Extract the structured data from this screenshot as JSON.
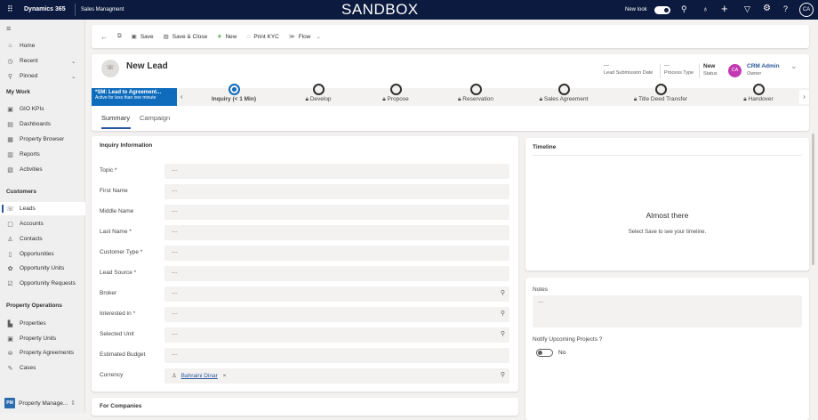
{
  "topbar": {
    "app": "Dynamics 365",
    "area": "Sales Managment",
    "env": "SANDBOX",
    "new_look": "New look",
    "avatar": "CA"
  },
  "sidebar": {
    "items_top": [
      {
        "icon": "home-icon",
        "label": "Home"
      },
      {
        "icon": "clock-icon",
        "label": "Recent"
      },
      {
        "icon": "pin-icon",
        "label": "Pinned"
      }
    ],
    "sections": [
      {
        "title": "My Work",
        "items": [
          {
            "icon": "kpi-icon",
            "label": "GIO KPIs"
          },
          {
            "icon": "dashboard-icon",
            "label": "Dashboards"
          },
          {
            "icon": "browser-icon",
            "label": "Property Browser"
          },
          {
            "icon": "report-icon",
            "label": "Reports"
          },
          {
            "icon": "activity-icon",
            "label": "Activities"
          }
        ]
      },
      {
        "title": "Customers",
        "items": [
          {
            "icon": "lead-icon",
            "label": "Leads"
          },
          {
            "icon": "account-icon",
            "label": "Accounts"
          },
          {
            "icon": "contact-icon",
            "label": "Contacts"
          },
          {
            "icon": "opportunity-icon",
            "label": "Opportunities"
          },
          {
            "icon": "unit-icon",
            "label": "Opportunity Units"
          },
          {
            "icon": "request-icon",
            "label": "Opportunity Requests"
          }
        ]
      },
      {
        "title": "Property Operations",
        "items": [
          {
            "icon": "property-icon",
            "label": "Properties"
          },
          {
            "icon": "property-unit-icon",
            "label": "Property Units"
          },
          {
            "icon": "agreement-icon",
            "label": "Property Agreements"
          },
          {
            "icon": "case-icon",
            "label": "Cases"
          }
        ]
      }
    ],
    "app_badge": "PM",
    "app_name": "Property Manage..."
  },
  "commands": {
    "save": "Save",
    "save_close": "Save & Close",
    "new": "New",
    "print_kyc": "Print KYC",
    "flow": "Flow"
  },
  "header": {
    "title": "New Lead",
    "fields": [
      {
        "value": "---",
        "label": "Lead Submission Date"
      },
      {
        "value": "---",
        "label": "Process Type"
      },
      {
        "value": "New",
        "label": "Status"
      }
    ],
    "owner_initials": "CA",
    "owner": "CRM Admin",
    "owner_label": "Owner"
  },
  "bpf": {
    "name": "*SM: Lead to Agreement...",
    "status": "Active for less than one minute",
    "stages": [
      "Inquiry  (< 1 Min)",
      "Develop",
      "Propose",
      "Reservation",
      "Sales Agreement",
      "Title Deed Transfer",
      "Handover"
    ]
  },
  "tabs": [
    "Summary",
    "Campaign"
  ],
  "inquiry": {
    "title": "Inquiry Information",
    "fields": [
      {
        "label": "Topic *",
        "value": "---",
        "lookup": false
      },
      {
        "label": "First Name",
        "value": "---",
        "lookup": false
      },
      {
        "label": "Middle Name",
        "value": "---",
        "lookup": false
      },
      {
        "label": "Last Name *",
        "value": "---",
        "lookup": false
      },
      {
        "label": "Customer Type *",
        "value": "---",
        "lookup": false
      },
      {
        "label": "Lead Source *",
        "value": "---",
        "lookup": false
      },
      {
        "label": "Broker",
        "value": "---",
        "lookup": true
      },
      {
        "label": "Interested in *",
        "value": "---",
        "lookup": true
      },
      {
        "label": "Selected Unit",
        "value": "---",
        "lookup": true
      },
      {
        "label": "Estimated Budget",
        "value": "---",
        "lookup": false
      }
    ],
    "currency_label": "Currency",
    "currency_value": "Bahraini Dinar"
  },
  "companies": {
    "title": "For Companies"
  },
  "timeline": {
    "title": "Timeline",
    "heading": "Almost there",
    "text": "Select Save to see your timeline."
  },
  "notes": {
    "label": "Notes",
    "value": "---",
    "notify_label": "Notify Upcoming Projects ?",
    "notify_value": "No"
  }
}
